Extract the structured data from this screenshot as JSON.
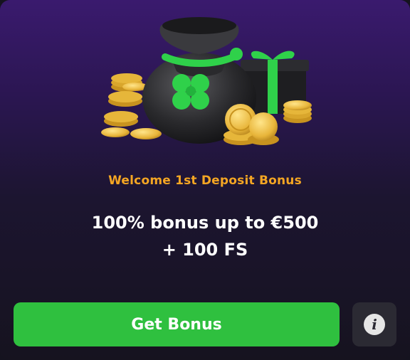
{
  "bonus": {
    "subtitle": "Welcome 1st Deposit Bonus",
    "offer_line1": "100% bonus up to €500",
    "offer_line2": "+ 100 FS",
    "cta_label": "Get Bonus",
    "info_glyph": "i"
  },
  "hero": {
    "illustration": "money-bag-clover-gift-coins",
    "icons": [
      "money-bag-icon",
      "clover-icon",
      "gift-box-icon",
      "gold-coin-icon"
    ]
  },
  "colors": {
    "accent_orange": "#f5a623",
    "cta_green": "#2fc03f",
    "info_button_bg": "#2b2a33",
    "bg_top": "#3a1a6e",
    "bg_bottom": "#16131f"
  }
}
